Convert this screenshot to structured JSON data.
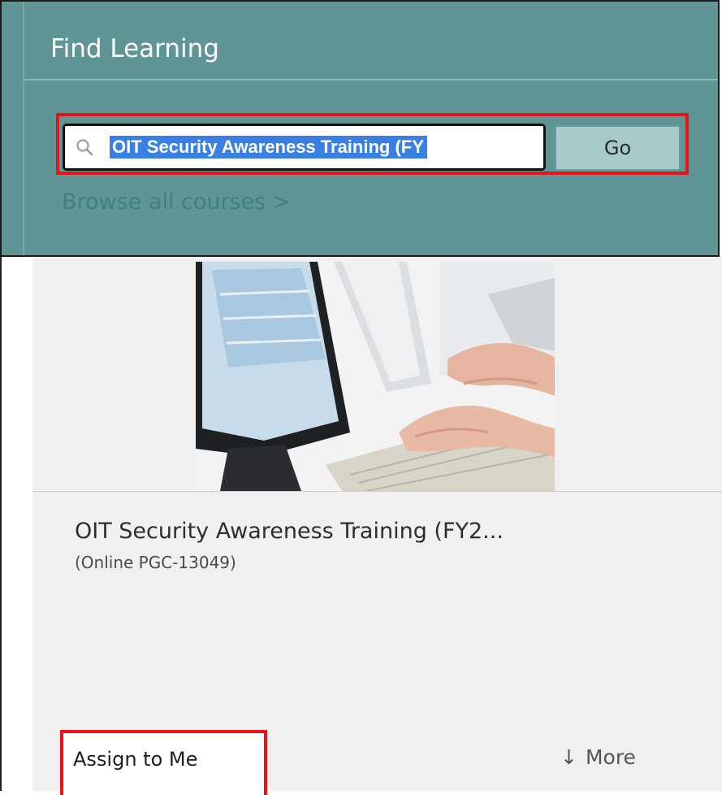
{
  "header": {
    "title": "Find Learning"
  },
  "search": {
    "value": "OIT Security Awareness Training (FY",
    "go_label": "Go"
  },
  "browse": {
    "label": "Browse all courses",
    "chevron": ">"
  },
  "course": {
    "title": "OIT Security Awareness Training (FY2...",
    "code": "(Online PGC-13049)",
    "assign_label": "Assign to Me",
    "more_label": "More",
    "more_arrow": "↓"
  },
  "colors": {
    "panel": "#5f9594",
    "highlight": "#e4141a",
    "selection": "#3a7fe3",
    "link": "#3f7f86"
  }
}
